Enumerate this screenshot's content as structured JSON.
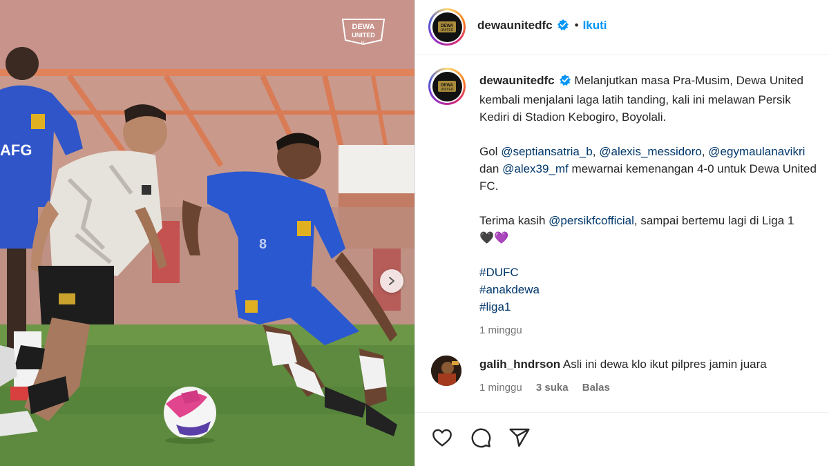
{
  "photo": {
    "watermark_label": "DEWA UNITED FC",
    "jersey_text": "AFG",
    "next_icon": "chevron-right-icon"
  },
  "post": {
    "username": "dewaunitedfc",
    "verified_icon": "verified-badge-icon",
    "follow_separator": "•",
    "follow_label": "Ikuti",
    "caption": {
      "line1_prefix": "Melanjutkan masa Pra-Musim, Dewa United",
      "line2": "kembali menjalani laga latih tanding, kali ini melawan Persik",
      "line3": "Kediri di Stadion Kebogiro, Boyolali.",
      "goals_prefix": "Gol",
      "mention1": "@septiansatria_b",
      "comma1": ",",
      "mention2": "@alexis_messidoro",
      "comma2": ",",
      "mention3": "@egymaulanavikri",
      "and": "dan",
      "mention4": "@alex39_mf",
      "goals_suffix": "mewarnai kemenangan 4-0 untuk Dewa United",
      "goals_suffix2": "FC.",
      "thanks_prefix": "Terima kasih",
      "mention5": "@persikfcofficial",
      "thanks_suffix": ", sampai bertemu lagi di Liga 1",
      "hearts": "🖤💜",
      "hashtags": [
        "#DUFC",
        "#anakdewa",
        "#liga1"
      ],
      "time": "1 minggu"
    },
    "comment": {
      "username": "galih_hndrson",
      "text": "Asli ini dewa klo ikut pilpres jamin juara",
      "time": "1 minggu",
      "likes": "3 suka",
      "reply": "Balas"
    },
    "actions": {
      "like_icon": "heart-icon",
      "comment_icon": "comment-icon",
      "share_icon": "share-icon"
    }
  },
  "colors": {
    "link": "#00376b",
    "follow": "#0095f6",
    "verified": "#0095f6",
    "muted": "#737373"
  }
}
